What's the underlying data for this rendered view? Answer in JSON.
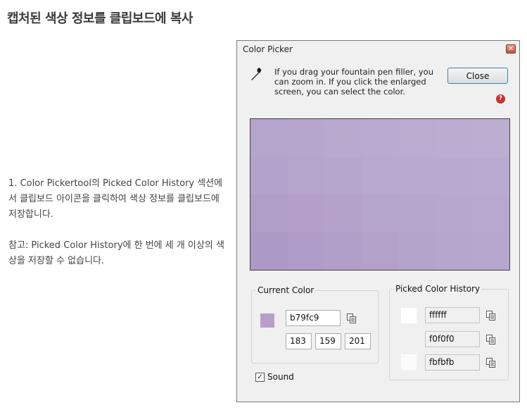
{
  "page": {
    "title": "캡처된 색상 정보를 클립보드에 복사",
    "paragraph1": "1. Color Pickertool의 Picked Color History 섹션에서 클립보드 아이콘을 클릭하여 색상 정보를 클립보드에 저장합니다.",
    "paragraph2": "참고: Picked Color History에 한 번에 세 개 이상의 색상을 저장할 수 없습니다."
  },
  "dialog": {
    "title": "Color Picker",
    "title_close": "✕",
    "instructions": "If you drag your fountain pen filler, you can zoom in. If you click the enlarged screen, you can select the color.",
    "close_label": "Close",
    "help_icon": "?",
    "current_color": {
      "label": "Current Color",
      "hex": "b79fc9",
      "r": "183",
      "g": "159",
      "b": "201",
      "swatch_color": "#b79fc9"
    },
    "history": {
      "label": "Picked Color History",
      "items": [
        {
          "hex": "ffffff",
          "color": "#ffffff"
        },
        {
          "hex": "f0f0f0",
          "color": "#f0f0f0"
        },
        {
          "hex": "fbfbfb",
          "color": "#fbfbfb"
        }
      ]
    },
    "sound_label": "Sound",
    "sound_checked": true
  }
}
